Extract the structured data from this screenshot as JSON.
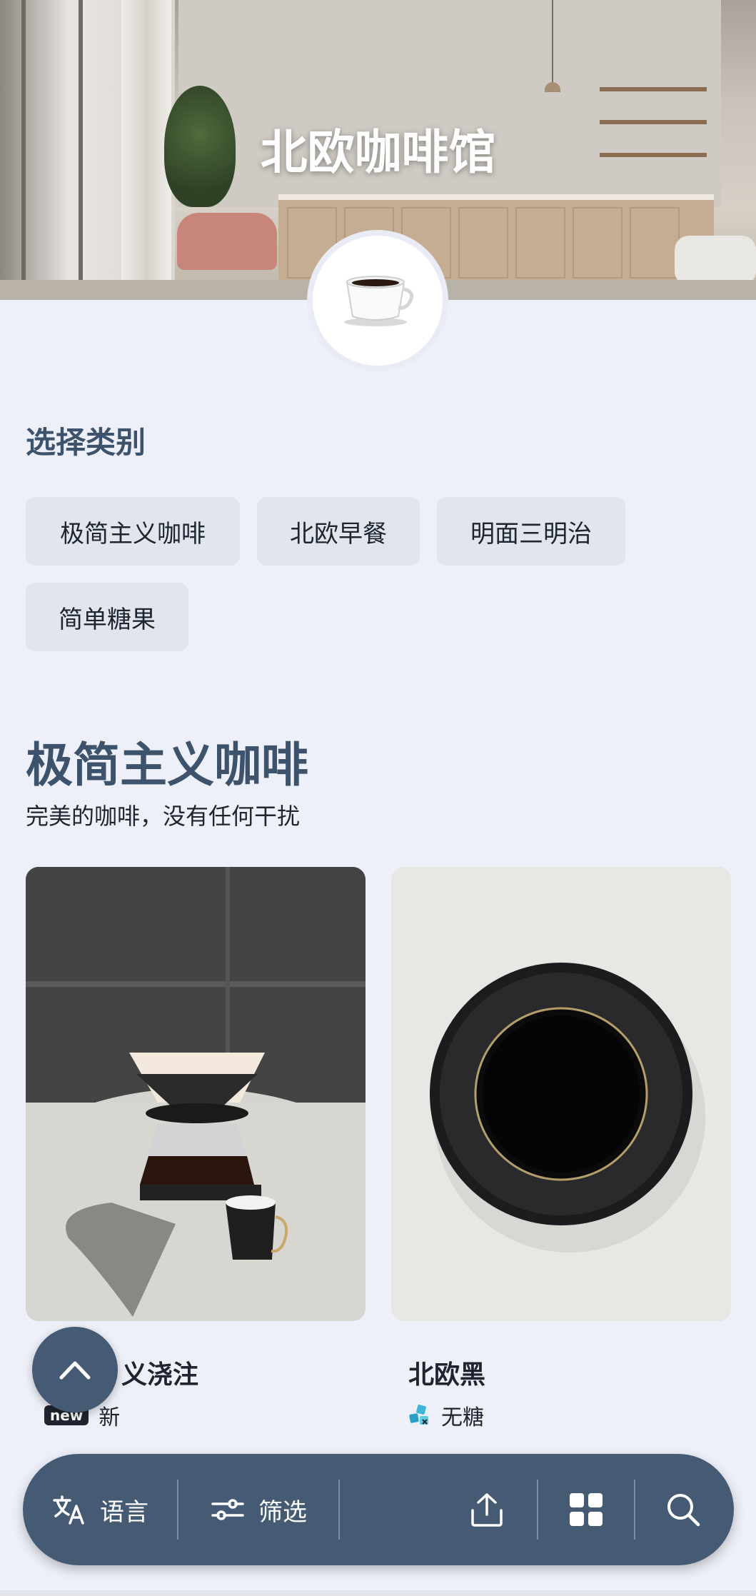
{
  "header": {
    "title": "北欧咖啡馆",
    "logo_icon": "coffee-cup-icon"
  },
  "categories": {
    "label": "选择类别",
    "chips": [
      "极简主义咖啡",
      "北欧早餐",
      "明面三明治",
      "简单糖果"
    ]
  },
  "section": {
    "title": "极简主义咖啡",
    "subtitle": "完美的咖啡，没有任何干扰"
  },
  "products": [
    {
      "name": "义浇注",
      "badge": "new",
      "tag": "新",
      "image_icon": "pour-over-coffee-image"
    },
    {
      "name": "北欧黑",
      "badge_icon": "sugar-cubes-icon",
      "tag": "无糖",
      "image_icon": "black-coffee-cup-image"
    }
  ],
  "bottom_bar": {
    "language_label": "语言",
    "filter_label": "筛选",
    "share_icon": "share-icon",
    "grid_icon": "grid-icon",
    "search_icon": "search-icon"
  },
  "colors": {
    "primary": "#455a73",
    "heading": "#3d536b",
    "background": "#eef0f9",
    "chip": "#e0e5ee"
  }
}
